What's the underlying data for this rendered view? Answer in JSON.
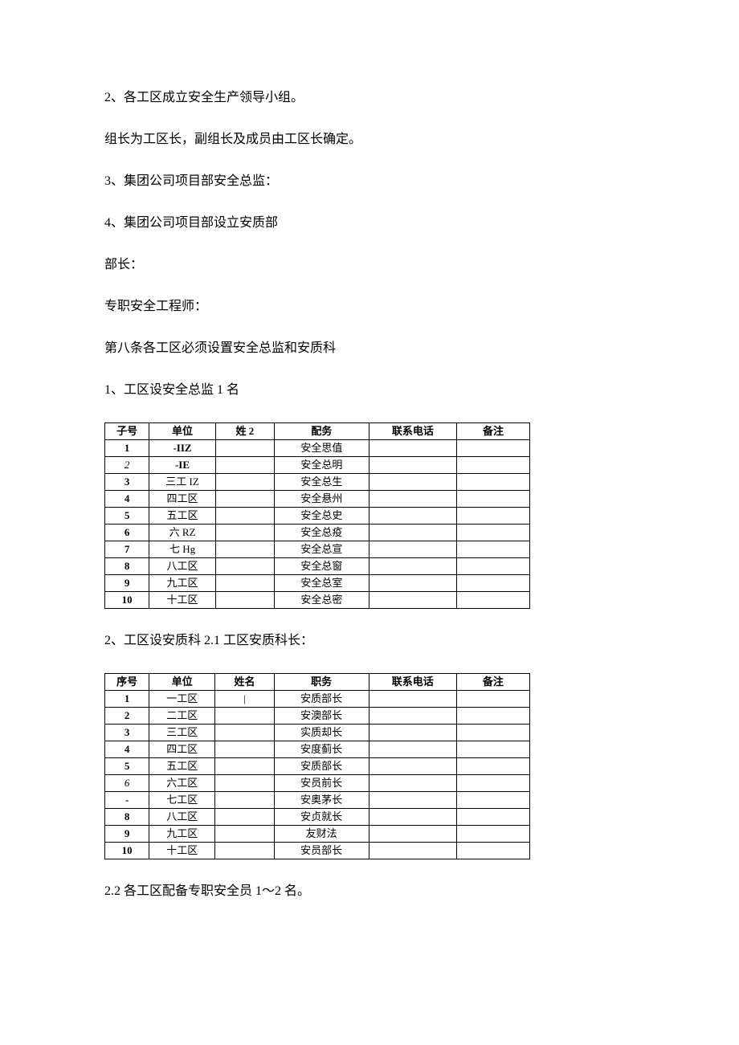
{
  "paragraphs": {
    "p1": "2、各工区成立安全生产领导小组。",
    "p2": "组长为工区长，副组长及成员由工区长确定。",
    "p3": "3、集团公司项目部安全总监：",
    "p4": "4、集团公司项目部设立安质部",
    "p5": "部长：",
    "p6": "专职安全工程师：",
    "p7": "第八条各工区必须设置安全总监和安质科",
    "p8": "1、工区设安全总监 1 名",
    "p9": "2、工区设安质科 2.1 工区安质科长：",
    "p10": "2.2 各工区配备专职安全员 1～2 名。"
  },
  "table1": {
    "headers": [
      "子号",
      "单位",
      "姓 2",
      "配务",
      "联系电话",
      "备注"
    ],
    "rows": [
      {
        "idx": "1",
        "idx_style": "bold",
        "unit": "-IIZ",
        "unit_style": "bold",
        "name": "",
        "pos": "安全思值",
        "phone": "",
        "note": ""
      },
      {
        "idx": "2",
        "idx_style": "italic",
        "unit": "-IE",
        "unit_style": "bold",
        "name": "",
        "pos": "安全总明",
        "phone": "",
        "note": ""
      },
      {
        "idx": "3",
        "idx_style": "bold",
        "unit": "三工 IZ",
        "unit_style": "",
        "name": "",
        "pos": "安全总生",
        "phone": "",
        "note": ""
      },
      {
        "idx": "4",
        "idx_style": "bold",
        "unit": "四工区",
        "unit_style": "",
        "name": "",
        "pos": "安全悬州",
        "phone": "",
        "note": ""
      },
      {
        "idx": "5",
        "idx_style": "bold",
        "unit": "五工区",
        "unit_style": "",
        "name": "",
        "pos": "安全总史",
        "phone": "",
        "note": ""
      },
      {
        "idx": "6",
        "idx_style": "bold",
        "unit": "六 RZ",
        "unit_style": "",
        "name": "",
        "pos": "安全总疫",
        "phone": "",
        "note": ""
      },
      {
        "idx": "7",
        "idx_style": "bold",
        "unit": "七 Hg",
        "unit_style": "",
        "name": "",
        "pos": "安全总宣",
        "phone": "",
        "note": ""
      },
      {
        "idx": "8",
        "idx_style": "bold",
        "unit": "八工区",
        "unit_style": "",
        "name": "",
        "pos": "安全总窗",
        "phone": "",
        "note": ""
      },
      {
        "idx": "9",
        "idx_style": "bold",
        "unit": "九工区",
        "unit_style": "",
        "name": "",
        "pos": "安全总室",
        "phone": "",
        "note": ""
      },
      {
        "idx": "10",
        "idx_style": "bold",
        "unit": "十工区",
        "unit_style": "",
        "name": "",
        "pos": "安全总密",
        "phone": "",
        "note": ""
      }
    ]
  },
  "table2": {
    "headers": [
      "序号",
      "单位",
      "姓名",
      "职务",
      "联系电话",
      "备注"
    ],
    "rows": [
      {
        "idx": "1",
        "idx_style": "bold",
        "unit": "一工区",
        "name": "|",
        "pos": "安质部长",
        "phone": "",
        "note": ""
      },
      {
        "idx": "2",
        "idx_style": "bold",
        "unit": "二工区",
        "name": "",
        "pos": "安澳部长",
        "phone": "",
        "note": ""
      },
      {
        "idx": "3",
        "idx_style": "bold",
        "unit": "三工区",
        "name": "",
        "pos": "实质却长",
        "phone": "",
        "note": ""
      },
      {
        "idx": "4",
        "idx_style": "bold",
        "unit": "四工区",
        "name": "",
        "pos": "安度蓟长",
        "phone": "",
        "note": ""
      },
      {
        "idx": "5",
        "idx_style": "bold",
        "unit": "五工区",
        "name": "",
        "pos": "安质部长",
        "phone": "",
        "note": ""
      },
      {
        "idx": "6",
        "idx_style": "italic",
        "unit": "六工区",
        "name": "",
        "pos": "安员前长",
        "phone": "",
        "note": ""
      },
      {
        "idx": "-",
        "idx_style": "bold",
        "unit": "七工区",
        "name": "",
        "pos": "安奥茅长",
        "phone": "",
        "note": ""
      },
      {
        "idx": "8",
        "idx_style": "bold",
        "unit": "八工区",
        "name": "",
        "pos": "安贞就长",
        "phone": "",
        "note": ""
      },
      {
        "idx": "9",
        "idx_style": "bold",
        "unit": "九工区",
        "name": "",
        "pos": "友财法",
        "phone": "",
        "note": ""
      },
      {
        "idx": "10",
        "idx_style": "bold",
        "unit": "十工区",
        "name": "",
        "pos": "安员部长",
        "phone": "",
        "note": ""
      }
    ]
  }
}
